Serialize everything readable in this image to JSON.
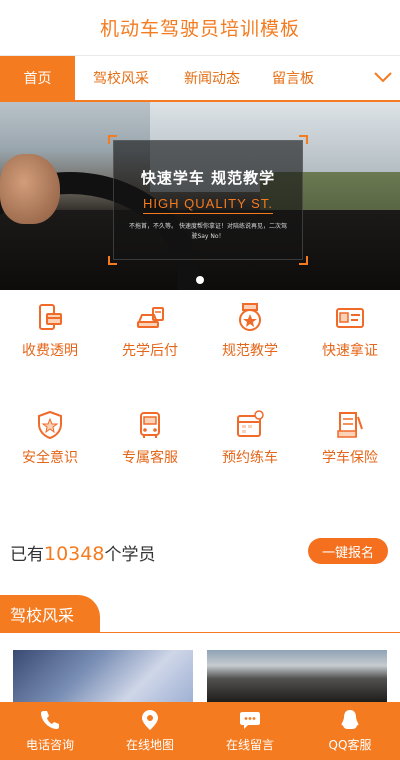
{
  "header": {
    "title": "机动车驾驶员培训模板"
  },
  "nav": {
    "tabs": [
      {
        "label": "首页",
        "active": true
      },
      {
        "label": "驾校风采",
        "active": false
      },
      {
        "label": "新闻动态",
        "active": false
      },
      {
        "label": "留言板",
        "active": false
      }
    ],
    "more_icon": "chevron-down-icon"
  },
  "banner": {
    "headline": "快速学车 规范教学",
    "subheadline": "HIGH QUALITY ST.",
    "slogan": "不拖首，不久等。 快速度帮你拿证！对陪练说再见，二次驾驶Say No！",
    "slide_count": 1,
    "active_slide": 1
  },
  "features": [
    {
      "label": "收费透明",
      "icon": "phone-card-icon"
    },
    {
      "label": "先学后付",
      "icon": "car-pay-icon"
    },
    {
      "label": "规范教学",
      "icon": "medal-icon"
    },
    {
      "label": "快速拿证",
      "icon": "license-card-icon"
    },
    {
      "label": "安全意识",
      "icon": "shield-star-icon"
    },
    {
      "label": "专属客服",
      "icon": "bus-icon"
    },
    {
      "label": "预约练车",
      "icon": "calendar-icon"
    },
    {
      "label": "学车保险",
      "icon": "document-pen-icon"
    }
  ],
  "students": {
    "prefix": "已有",
    "count": "10348",
    "suffix": "个学员",
    "signup_label": "一键报名"
  },
  "section": {
    "title": "驾校风采"
  },
  "footer": {
    "items": [
      {
        "label": "电话咨询",
        "icon": "phone-icon"
      },
      {
        "label": "在线地图",
        "icon": "map-pin-icon"
      },
      {
        "label": "在线留言",
        "icon": "chat-bubble-icon"
      },
      {
        "label": "QQ客服",
        "icon": "qq-penguin-icon"
      }
    ]
  },
  "colors": {
    "accent": "#f57b20",
    "label": "#e4661a",
    "text": "#333333"
  }
}
